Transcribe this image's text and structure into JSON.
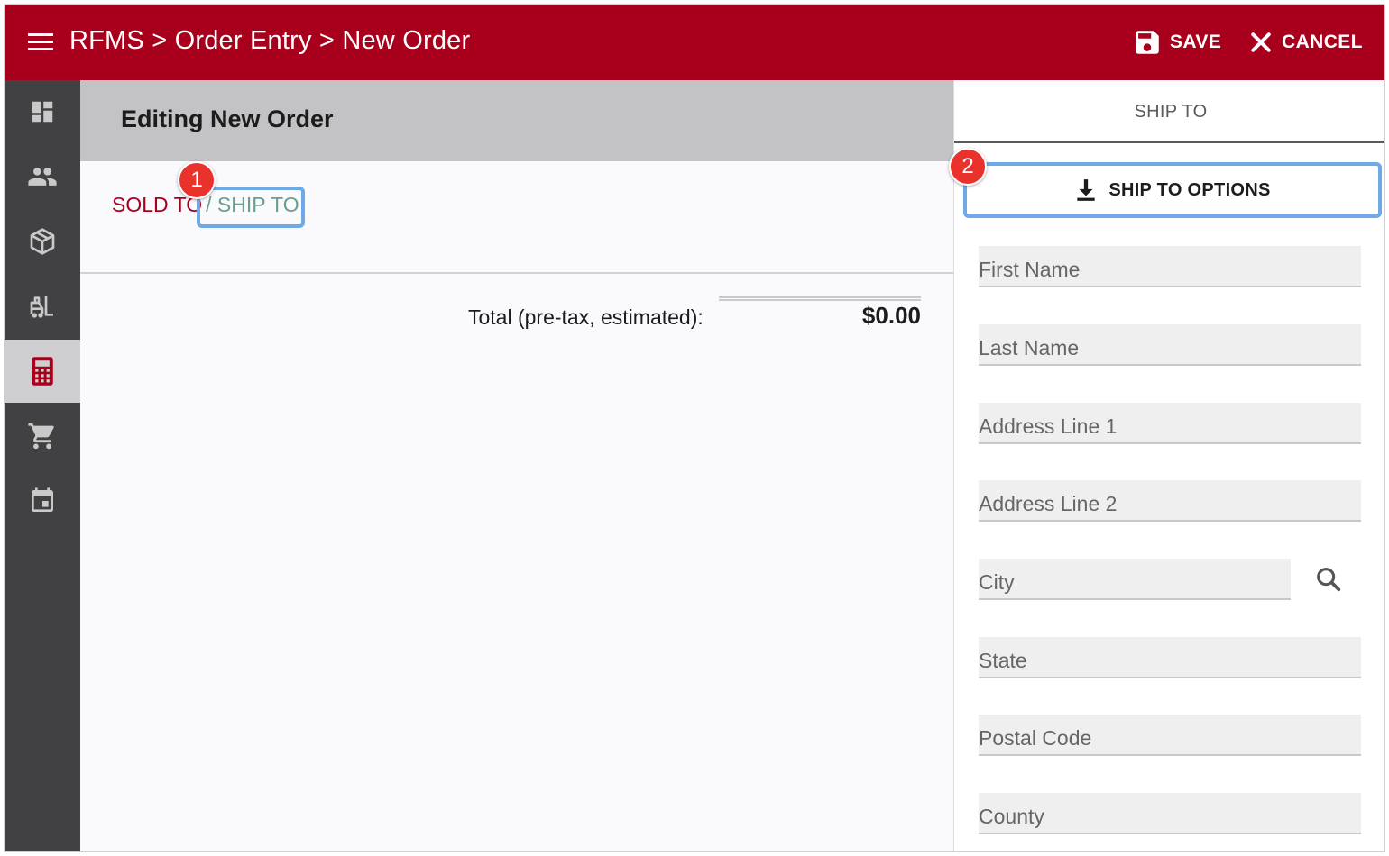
{
  "header": {
    "breadcrumb": "RFMS > Order Entry > New Order",
    "save_label": "SAVE",
    "cancel_label": "CANCEL"
  },
  "sidebar": {
    "items": [
      {
        "icon": "dashboard-icon"
      },
      {
        "icon": "customers-icon"
      },
      {
        "icon": "products-icon"
      },
      {
        "icon": "forklift-icon"
      },
      {
        "icon": "calculator-icon",
        "active": true
      },
      {
        "icon": "cart-icon"
      },
      {
        "icon": "calendar-icon"
      }
    ]
  },
  "main": {
    "title": "Editing New Order",
    "sold_to": "SOLD TO",
    "ship_to": "/ SHIP TO",
    "total_label": "Total (pre-tax, estimated):",
    "total_value": "$0.00"
  },
  "panel": {
    "tab_label": "SHIP TO",
    "options_button": "SHIP TO OPTIONS",
    "fields": {
      "first_name": "First Name",
      "last_name": "Last Name",
      "address1": "Address Line 1",
      "address2": "Address Line 2",
      "city": "City",
      "state": "State",
      "postal_code": "Postal Code",
      "county": "County"
    }
  },
  "callouts": {
    "one": "1",
    "two": "2"
  },
  "colors": {
    "brand": "#a8001c",
    "rail": "#414042",
    "highlight": "#6fa9e6",
    "callout": "#e8322b",
    "ship_to_link": "#6a9f8e"
  }
}
